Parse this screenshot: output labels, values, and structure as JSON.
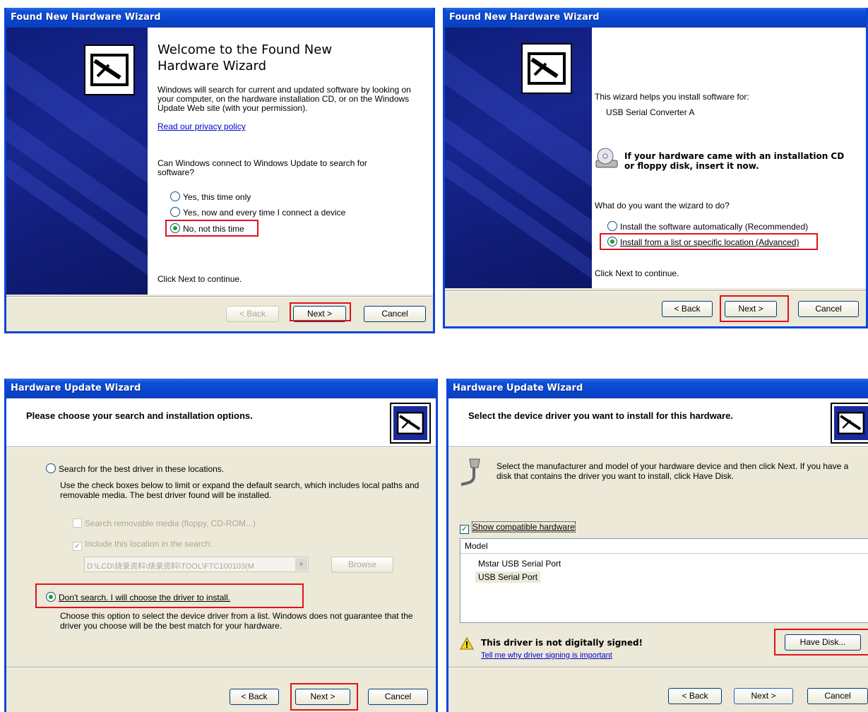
{
  "panel1": {
    "title": "Found New Hardware Wizard",
    "heading": "Welcome to the Found New Hardware Wizard",
    "intro": "Windows will search for current and updated software by looking on your computer, on the hardware installation CD, or on the Windows Update Web site (with your permission).",
    "privacy_link": "Read our privacy policy",
    "question": "Can Windows connect to Windows Update to search for software?",
    "options": [
      "Yes, this time only",
      "Yes, now and every time I connect a device",
      "No, not this time"
    ],
    "selected_index": 2,
    "footer_hint": "Click Next to continue.",
    "back": "< Back",
    "next": "Next >",
    "cancel": "Cancel"
  },
  "panel2": {
    "title": "Found New Hardware Wizard",
    "helps": "This wizard helps you install software for:",
    "device": "USB Serial Converter A",
    "cd_notice": "If your hardware came with an installation CD or floppy disk, insert it now.",
    "question": "What do you want the wizard to do?",
    "options": [
      "Install the software automatically (Recommended)",
      "Install from a list or specific location (Advanced)"
    ],
    "selected_index": 1,
    "footer_hint": "Click Next to continue.",
    "back": "< Back",
    "next": "Next >",
    "cancel": "Cancel"
  },
  "panel3": {
    "title": "Hardware Update Wizard",
    "header": "Please choose your search and installation options.",
    "option_search": "Search for the best driver in these locations.",
    "search_desc": "Use the check boxes below to limit or expand the default search, which includes local paths and removable media. The best driver found will be installed.",
    "chk_removable": "Search removable media (floppy, CD-ROM...)",
    "chk_location": "Include this location in the search:",
    "path_value": "D:\\LCD\\烧录资料\\烧录资料\\TOOL\\FTC100103(M",
    "browse": "Browse",
    "option_dont": "Don't search. I will choose the driver to install.",
    "dont_desc": "Choose this option to select the device driver from a list.  Windows does not guarantee that the driver you choose will be the best match for your hardware.",
    "selected": "dont",
    "back": "< Back",
    "next": "Next >",
    "cancel": "Cancel"
  },
  "panel4": {
    "title": "Hardware Update Wizard",
    "header": "Select the device driver you want to install for this hardware.",
    "instructions": "Select the manufacturer and model of your hardware device and then click Next. If you have a disk that contains the driver you want to install, click Have Disk.",
    "show_compatible": "Show compatible hardware",
    "show_compatible_checked": true,
    "column_model": "Model",
    "models": [
      "Mstar USB Serial Port",
      "USB Serial Port"
    ],
    "selected_model_index": 1,
    "warning": "This driver is not digitally signed!",
    "signing_link": "Tell me why driver signing is important",
    "have_disk": "Have Disk...",
    "back": "< Back",
    "next": "Next >",
    "cancel": "Cancel"
  },
  "colors": {
    "title_blue": "#0845cf",
    "dialog_bg": "#ece9d8",
    "highlight_red": "#e0121b",
    "side_navy": "#17258e"
  }
}
